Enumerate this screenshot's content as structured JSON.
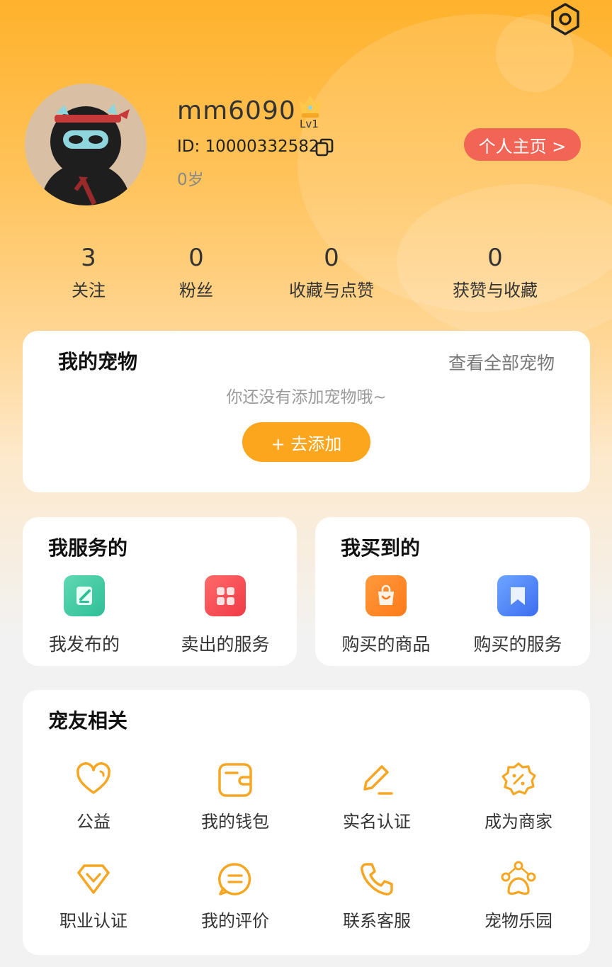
{
  "header": {
    "settings_icon": "settings-hex-icon",
    "username": "mm6090",
    "level": "Lv1",
    "user_id": "ID: 10000332582",
    "age": "0岁",
    "homepage_button": "个人主页 >"
  },
  "stats": [
    {
      "value": "3",
      "label": "关注"
    },
    {
      "value": "0",
      "label": "粉丝"
    },
    {
      "value": "0",
      "label": "收藏与点赞"
    },
    {
      "value": "0",
      "label": "获赞与收藏"
    }
  ],
  "pets": {
    "title": "我的宠物",
    "view_all": "查看全部宠物",
    "empty_text": "你还没有添加宠物哦~",
    "add_button": "+ 去添加"
  },
  "my_services": {
    "title": "我服务的",
    "items": [
      {
        "label": "我发布的",
        "icon": "note-edit-icon"
      },
      {
        "label": "卖出的服务",
        "icon": "grid-icon"
      }
    ]
  },
  "my_purchases": {
    "title": "我买到的",
    "items": [
      {
        "label": "购买的商品",
        "icon": "shopping-bag-icon"
      },
      {
        "label": "购买的服务",
        "icon": "bookmark-icon"
      }
    ]
  },
  "pet_friends": {
    "title": "宠友相关",
    "items": [
      {
        "label": "公益",
        "icon": "heart-icon"
      },
      {
        "label": "我的钱包",
        "icon": "wallet-icon"
      },
      {
        "label": "实名认证",
        "icon": "pencil-icon"
      },
      {
        "label": "成为商家",
        "icon": "discount-badge-icon"
      },
      {
        "label": "职业认证",
        "icon": "diamond-icon"
      },
      {
        "label": "我的评价",
        "icon": "comment-icon"
      },
      {
        "label": "联系客服",
        "icon": "phone-icon"
      },
      {
        "label": "宠物乐园",
        "icon": "pet-park-icon"
      }
    ]
  },
  "colors": {
    "accent": "#fca61d",
    "homepage_button": "#f26455",
    "icon_stroke": "#f6a623"
  }
}
